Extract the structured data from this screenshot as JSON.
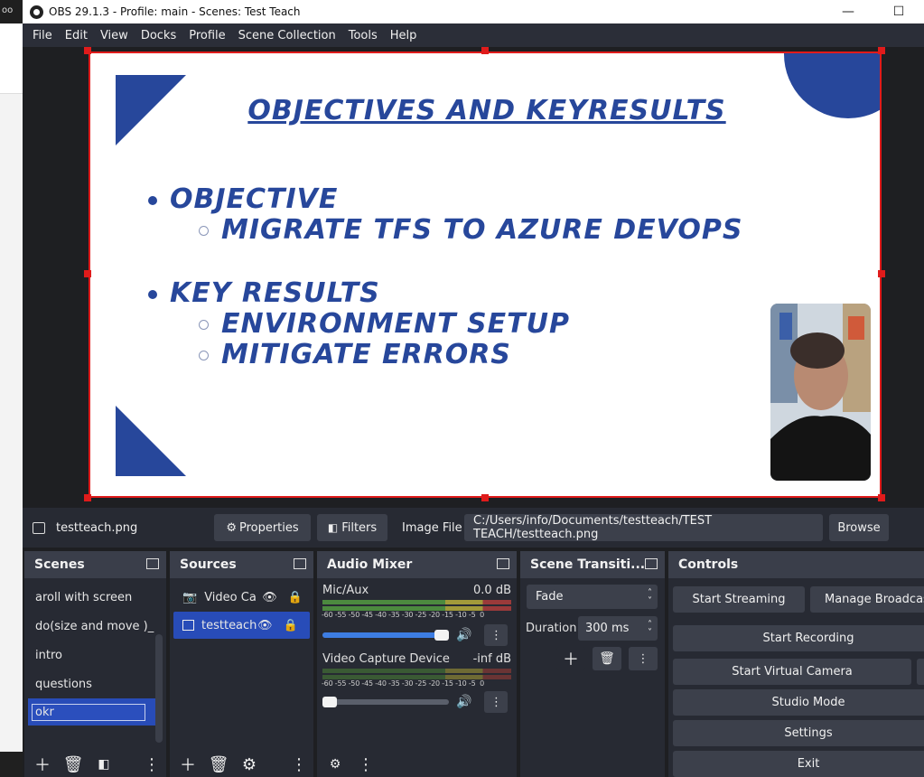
{
  "window": {
    "title": "OBS 29.1.3 - Profile: main - Scenes: Test Teach",
    "left_edge_fragment": "oo"
  },
  "menu": [
    "File",
    "Edit",
    "View",
    "Docks",
    "Profile",
    "Scene Collection",
    "Tools",
    "Help"
  ],
  "slide": {
    "title": "OBJECTIVES AND KEYRESULTS",
    "bullet1": "OBJECTIVE",
    "sub1": "MIGRATE TFS TO AZURE DEVOPS",
    "bullet2": "KEY RESULTS",
    "sub2a": "ENVIRONMENT SETUP",
    "sub2b": "MITIGATE ERRORS",
    "accent_color": "#27479b"
  },
  "source_toolbar": {
    "source_name": "testteach.png",
    "properties_label": "Properties",
    "filters_label": "Filters",
    "image_file_label": "Image File",
    "image_file_path": "C:/Users/info/Documents/testteach/TEST TEACH/testteach.png",
    "browse_label": "Browse"
  },
  "scenes": {
    "title": "Scenes",
    "items": [
      "aroll with screen",
      "do(size and move )_",
      "intro",
      "questions",
      "okr"
    ]
  },
  "sources": {
    "title": "Sources",
    "items": [
      "Video Cap",
      "testteach"
    ]
  },
  "audio_mixer": {
    "title": "Audio Mixer",
    "ticks": "-60 -55 -50 -45 -40 -35 -30 -25 -20 -15 -10 -5  0",
    "channels": [
      {
        "name": "Mic/Aux",
        "level": "0.0 dB",
        "volume": 1.0
      },
      {
        "name": "Video Capture Device",
        "level": "-inf dB",
        "volume": 0.1
      }
    ]
  },
  "transitions": {
    "title": "Scene Transiti...",
    "selected": "Fade",
    "duration_label": "Duration",
    "duration_value": "300 ms"
  },
  "controls": {
    "title": "Controls",
    "start_streaming": "Start Streaming",
    "manage_broadcast": "Manage Broadcast",
    "start_recording": "Start Recording",
    "start_virtual_camera": "Start Virtual Camera",
    "studio_mode": "Studio Mode",
    "settings": "Settings",
    "exit": "Exit"
  }
}
